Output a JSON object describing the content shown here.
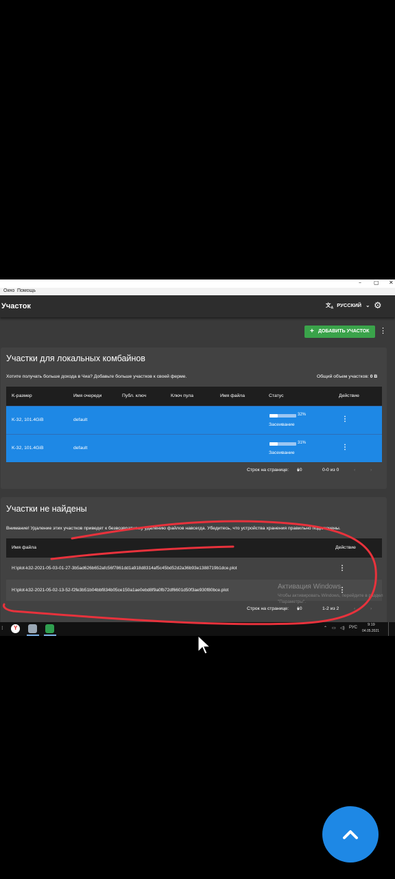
{
  "window": {
    "controls": [
      "–",
      "▢",
      "✕"
    ],
    "menu": [
      "Окно",
      "Помощь"
    ]
  },
  "appbar": {
    "title": "Участок",
    "language": "РУССКИЙ",
    "language_icon": "translate-icon",
    "settings_icon": "gear-icon"
  },
  "toolbar": {
    "add_plot_label": "ДОБАВИТЬ УЧАСТОК"
  },
  "local_plots": {
    "title": "Участки для локальных комбайнов",
    "info_text": "Хотите получать больше дохода в Чиа? Добавьте больше участков к своей ферме.",
    "total_size_label": "Общий объем участков:",
    "total_size_value": "0 B",
    "columns": [
      "K-размер",
      "Имя очереди",
      "Публ. ключ",
      "Ключ пула",
      "Имя файла",
      "Статус",
      "Действие"
    ],
    "rows": [
      {
        "k_size": "K-32, 101.4GiB",
        "queue": "default",
        "progress_text": "32%",
        "progress": 0.32,
        "status": "Засеивание"
      },
      {
        "k_size": "K-32, 101.4GiB",
        "queue": "default",
        "progress_text": "31%",
        "progress": 0.31,
        "status": "Засеивание"
      }
    ],
    "pager": {
      "rows_per_page_label": "Строк на странице:",
      "rows_per_page": "10",
      "range": "0-0 из 0"
    }
  },
  "not_found": {
    "title": "Участки не найдены",
    "warning": "Внимание! Удаление этих участков приведет к безвозвратному удалению файлов навсегда. Убедитесь, что устройства хранения правильно подключены.",
    "columns": [
      "Имя файла",
      "Действие"
    ],
    "rows": [
      {
        "filename": "H:\\plot-k32-2021-05-03-01-27-3b5ad626b652afc56f7861dd1a918d8314af5c45bd52d2a36b93e1388719b1dce.plot"
      },
      {
        "filename": "H:\\plot-k32-2021-05-02-13-52-f2fe3b51b04bbf834b05ce150a1ae0ebd8f9a0fb72df6601d50f3ae930f80bce.plot"
      }
    ],
    "pager": {
      "rows_per_page_label": "Строк на странице:",
      "rows_per_page": "10",
      "range": "1-2 из 2"
    }
  },
  "watermark": {
    "title": "Активация Windows",
    "text": "Чтобы активировать Windows, перейдите в раздел \"Параметры\"."
  },
  "taskbar": {
    "language": "РУС",
    "time": "9:19",
    "date": "04.05.2021"
  },
  "colors": {
    "accent_blue": "#1e88e5",
    "add_green": "#3aa34a",
    "annotation_red": "#e8323c"
  }
}
